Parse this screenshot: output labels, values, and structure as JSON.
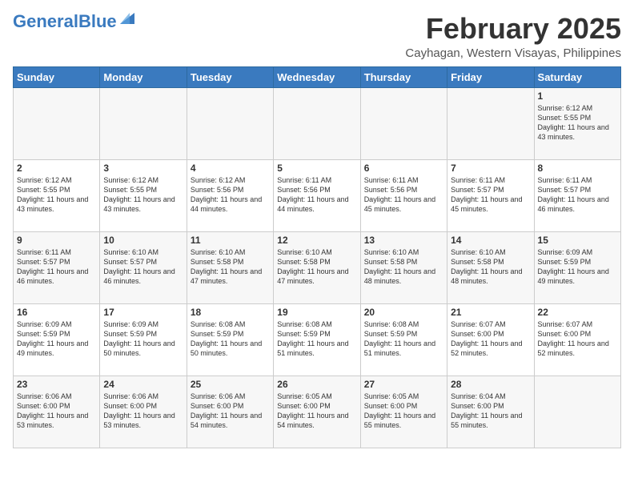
{
  "header": {
    "logo_general": "General",
    "logo_blue": "Blue",
    "month_title": "February 2025",
    "location": "Cayhagan, Western Visayas, Philippines"
  },
  "weekdays": [
    "Sunday",
    "Monday",
    "Tuesday",
    "Wednesday",
    "Thursday",
    "Friday",
    "Saturday"
  ],
  "weeks": [
    [
      {
        "day": "",
        "sunrise": "",
        "sunset": "",
        "daylight": ""
      },
      {
        "day": "",
        "sunrise": "",
        "sunset": "",
        "daylight": ""
      },
      {
        "day": "",
        "sunrise": "",
        "sunset": "",
        "daylight": ""
      },
      {
        "day": "",
        "sunrise": "",
        "sunset": "",
        "daylight": ""
      },
      {
        "day": "",
        "sunrise": "",
        "sunset": "",
        "daylight": ""
      },
      {
        "day": "",
        "sunrise": "",
        "sunset": "",
        "daylight": ""
      },
      {
        "day": "1",
        "sunrise": "Sunrise: 6:12 AM",
        "sunset": "Sunset: 5:55 PM",
        "daylight": "Daylight: 11 hours and 43 minutes."
      }
    ],
    [
      {
        "day": "2",
        "sunrise": "Sunrise: 6:12 AM",
        "sunset": "Sunset: 5:55 PM",
        "daylight": "Daylight: 11 hours and 43 minutes."
      },
      {
        "day": "3",
        "sunrise": "Sunrise: 6:12 AM",
        "sunset": "Sunset: 5:55 PM",
        "daylight": "Daylight: 11 hours and 43 minutes."
      },
      {
        "day": "4",
        "sunrise": "Sunrise: 6:12 AM",
        "sunset": "Sunset: 5:56 PM",
        "daylight": "Daylight: 11 hours and 44 minutes."
      },
      {
        "day": "5",
        "sunrise": "Sunrise: 6:11 AM",
        "sunset": "Sunset: 5:56 PM",
        "daylight": "Daylight: 11 hours and 44 minutes."
      },
      {
        "day": "6",
        "sunrise": "Sunrise: 6:11 AM",
        "sunset": "Sunset: 5:56 PM",
        "daylight": "Daylight: 11 hours and 45 minutes."
      },
      {
        "day": "7",
        "sunrise": "Sunrise: 6:11 AM",
        "sunset": "Sunset: 5:57 PM",
        "daylight": "Daylight: 11 hours and 45 minutes."
      },
      {
        "day": "8",
        "sunrise": "Sunrise: 6:11 AM",
        "sunset": "Sunset: 5:57 PM",
        "daylight": "Daylight: 11 hours and 46 minutes."
      }
    ],
    [
      {
        "day": "9",
        "sunrise": "Sunrise: 6:11 AM",
        "sunset": "Sunset: 5:57 PM",
        "daylight": "Daylight: 11 hours and 46 minutes."
      },
      {
        "day": "10",
        "sunrise": "Sunrise: 6:10 AM",
        "sunset": "Sunset: 5:57 PM",
        "daylight": "Daylight: 11 hours and 46 minutes."
      },
      {
        "day": "11",
        "sunrise": "Sunrise: 6:10 AM",
        "sunset": "Sunset: 5:58 PM",
        "daylight": "Daylight: 11 hours and 47 minutes."
      },
      {
        "day": "12",
        "sunrise": "Sunrise: 6:10 AM",
        "sunset": "Sunset: 5:58 PM",
        "daylight": "Daylight: 11 hours and 47 minutes."
      },
      {
        "day": "13",
        "sunrise": "Sunrise: 6:10 AM",
        "sunset": "Sunset: 5:58 PM",
        "daylight": "Daylight: 11 hours and 48 minutes."
      },
      {
        "day": "14",
        "sunrise": "Sunrise: 6:10 AM",
        "sunset": "Sunset: 5:58 PM",
        "daylight": "Daylight: 11 hours and 48 minutes."
      },
      {
        "day": "15",
        "sunrise": "Sunrise: 6:09 AM",
        "sunset": "Sunset: 5:59 PM",
        "daylight": "Daylight: 11 hours and 49 minutes."
      }
    ],
    [
      {
        "day": "16",
        "sunrise": "Sunrise: 6:09 AM",
        "sunset": "Sunset: 5:59 PM",
        "daylight": "Daylight: 11 hours and 49 minutes."
      },
      {
        "day": "17",
        "sunrise": "Sunrise: 6:09 AM",
        "sunset": "Sunset: 5:59 PM",
        "daylight": "Daylight: 11 hours and 50 minutes."
      },
      {
        "day": "18",
        "sunrise": "Sunrise: 6:08 AM",
        "sunset": "Sunset: 5:59 PM",
        "daylight": "Daylight: 11 hours and 50 minutes."
      },
      {
        "day": "19",
        "sunrise": "Sunrise: 6:08 AM",
        "sunset": "Sunset: 5:59 PM",
        "daylight": "Daylight: 11 hours and 51 minutes."
      },
      {
        "day": "20",
        "sunrise": "Sunrise: 6:08 AM",
        "sunset": "Sunset: 5:59 PM",
        "daylight": "Daylight: 11 hours and 51 minutes."
      },
      {
        "day": "21",
        "sunrise": "Sunrise: 6:07 AM",
        "sunset": "Sunset: 6:00 PM",
        "daylight": "Daylight: 11 hours and 52 minutes."
      },
      {
        "day": "22",
        "sunrise": "Sunrise: 6:07 AM",
        "sunset": "Sunset: 6:00 PM",
        "daylight": "Daylight: 11 hours and 52 minutes."
      }
    ],
    [
      {
        "day": "23",
        "sunrise": "Sunrise: 6:06 AM",
        "sunset": "Sunset: 6:00 PM",
        "daylight": "Daylight: 11 hours and 53 minutes."
      },
      {
        "day": "24",
        "sunrise": "Sunrise: 6:06 AM",
        "sunset": "Sunset: 6:00 PM",
        "daylight": "Daylight: 11 hours and 53 minutes."
      },
      {
        "day": "25",
        "sunrise": "Sunrise: 6:06 AM",
        "sunset": "Sunset: 6:00 PM",
        "daylight": "Daylight: 11 hours and 54 minutes."
      },
      {
        "day": "26",
        "sunrise": "Sunrise: 6:05 AM",
        "sunset": "Sunset: 6:00 PM",
        "daylight": "Daylight: 11 hours and 54 minutes."
      },
      {
        "day": "27",
        "sunrise": "Sunrise: 6:05 AM",
        "sunset": "Sunset: 6:00 PM",
        "daylight": "Daylight: 11 hours and 55 minutes."
      },
      {
        "day": "28",
        "sunrise": "Sunrise: 6:04 AM",
        "sunset": "Sunset: 6:00 PM",
        "daylight": "Daylight: 11 hours and 55 minutes."
      },
      {
        "day": "",
        "sunrise": "",
        "sunset": "",
        "daylight": ""
      }
    ]
  ]
}
